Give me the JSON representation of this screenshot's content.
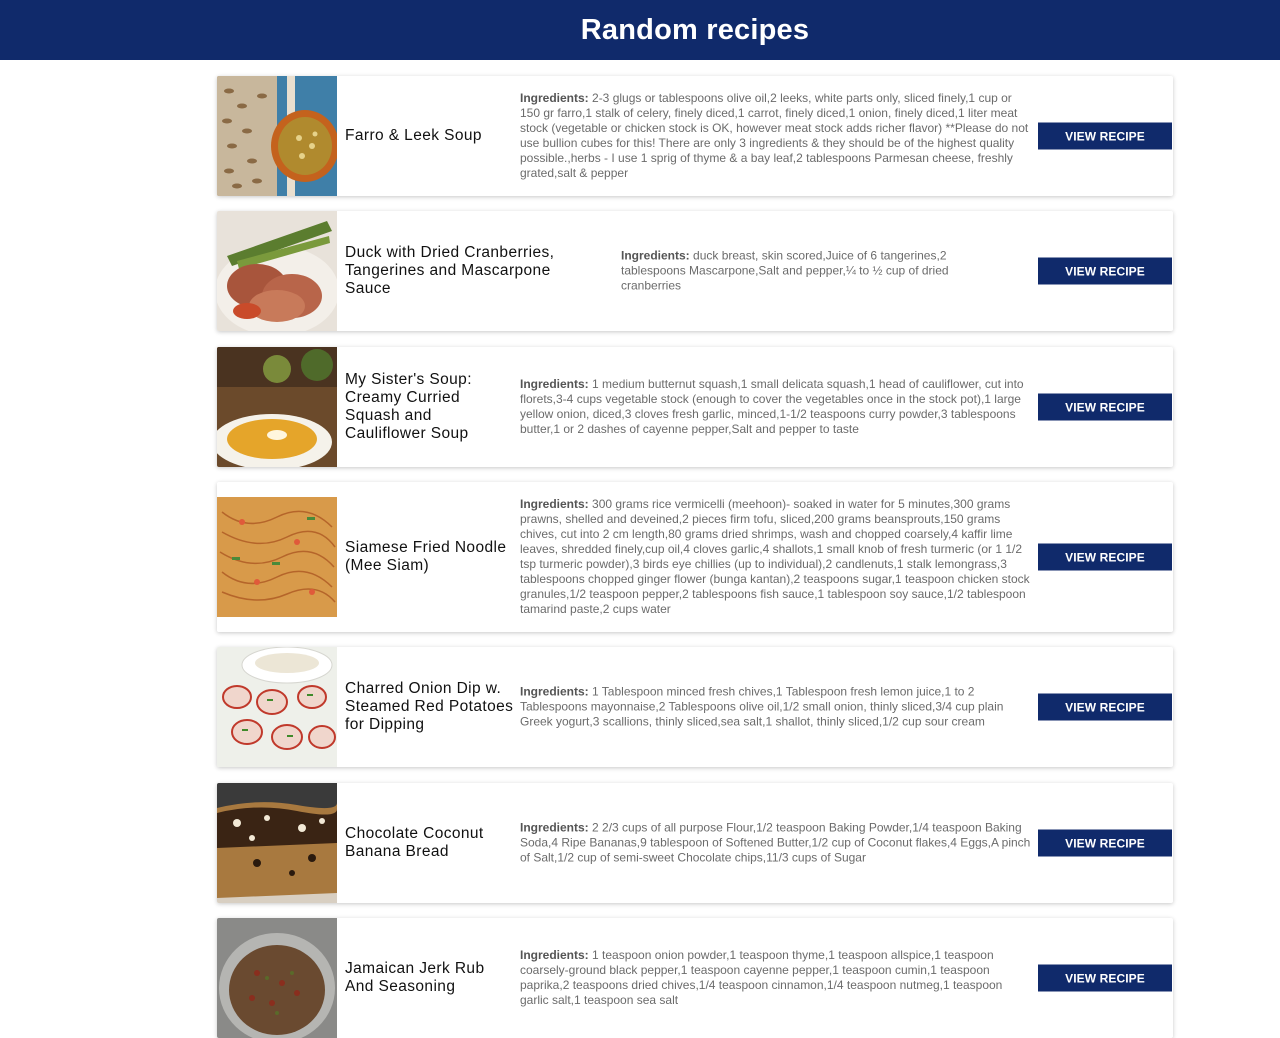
{
  "header": {
    "title": "Random recipes"
  },
  "ingredients_label": "Ingredients:",
  "recipes": [
    {
      "title": "Farro & Leek Soup",
      "ingredients": "2-3 glugs or tablespoons olive oil,2 leeks, white parts only, sliced finely,1 cup or 150 gr farro,1 stalk of celery, finely diced,1 carrot, finely diced,1 onion, finely diced,1 liter meat stock (vegetable or chicken stock is OK, however meat stock adds richer flavor) **Please do not use bullion cubes for this! There are only 3 ingredients & they should be of the highest quality possible.,herbs - I use 1 sprig of thyme & a bay leaf,2 tablespoons Parmesan cheese, freshly grated,salt & pepper",
      "button": "VIEW RECIPE"
    },
    {
      "title": "Duck with Dried Cranberries, Tangerines and Mascarpone Sauce",
      "ingredients": "duck breast, skin scored,Juice of 6 tangerines,2 tablespoons Mascarpone,Salt and pepper,¼ to ½ cup of dried cranberries",
      "button": "VIEW RECIPE"
    },
    {
      "title": "My Sister's Soup: Creamy Curried Squash and Cauliflower Soup",
      "ingredients": "1 medium butternut squash,1 small delicata squash,1 head of cauliflower, cut into florets,3-4 cups vegetable stock (enough to cover the vegetables once in the stock pot),1 large yellow onion, diced,3 cloves fresh garlic, minced,1-1/2 teaspoons curry powder,3 tablespoons butter,1 or 2 dashes of cayenne pepper,Salt and pepper to taste",
      "button": "VIEW RECIPE"
    },
    {
      "title": "Siamese Fried Noodle (Mee Siam)",
      "ingredients": "300 grams rice vermicelli (meehoon)- soaked in water for 5 minutes,300 grams prawns, shelled and deveined,2 pieces firm tofu, sliced,200 grams beansprouts,150 grams chives, cut into 2 cm length,80 grams dried shrimps, wash and chopped coarsely,4 kaffir lime leaves, shredded finely,cup oil,4 cloves garlic,4 shallots,1 small knob of fresh turmeric (or 1 1/2 tsp turmeric powder),3 birds eye chillies (up to individual),2 candlenuts,1 stalk lemongrass,3 tablespoons chopped ginger flower (bunga kantan),2 teaspoons sugar,1 teaspoon chicken stock granules,1/2 teaspoon pepper,2 tablespoons fish sauce,1 tablespoon soy sauce,1/2 tablespoon tamarind paste,2 cups water",
      "button": "VIEW RECIPE"
    },
    {
      "title": "Charred Onion Dip w. Steamed Red Potatoes for Dipping",
      "ingredients": "1 Tablespoon minced fresh chives,1 Tablespoon fresh lemon juice,1 to 2 Tablespoons mayonnaise,2 Tablespoons olive oil,1/2 small onion, thinly sliced,3/4 cup plain Greek yogurt,3 scallions, thinly sliced,sea salt,1 shallot, thinly sliced,1/2 cup sour cream",
      "button": "VIEW RECIPE"
    },
    {
      "title": "Chocolate Coconut Banana Bread",
      "ingredients": "2 2/3 cups of all purpose Flour,1/2 teaspoon Baking Powder,1/4 teaspoon Baking Soda,4 Ripe Bananas,9 tablespoon of Softened Butter,1/2 cup of Coconut flakes,4 Eggs,A pinch of Salt,1/2 cup of semi-sweet Chocolate chips,11/3 cups of Sugar",
      "button": "VIEW RECIPE"
    },
    {
      "title": "Jamaican Jerk Rub And Seasoning",
      "ingredients": "1 teaspoon onion powder,1 teaspoon thyme,1 teaspoon allspice,1 teaspoon coarsely-ground black pepper,1 teaspoon cayenne pepper,1 teaspoon cumin,1 teaspoon paprika,2 teaspoons dried chives,1/4 teaspoon cinnamon,1/4 teaspoon nutmeg,1 teaspoon garlic salt,1 teaspoon sea salt",
      "button": "VIEW RECIPE"
    }
  ]
}
